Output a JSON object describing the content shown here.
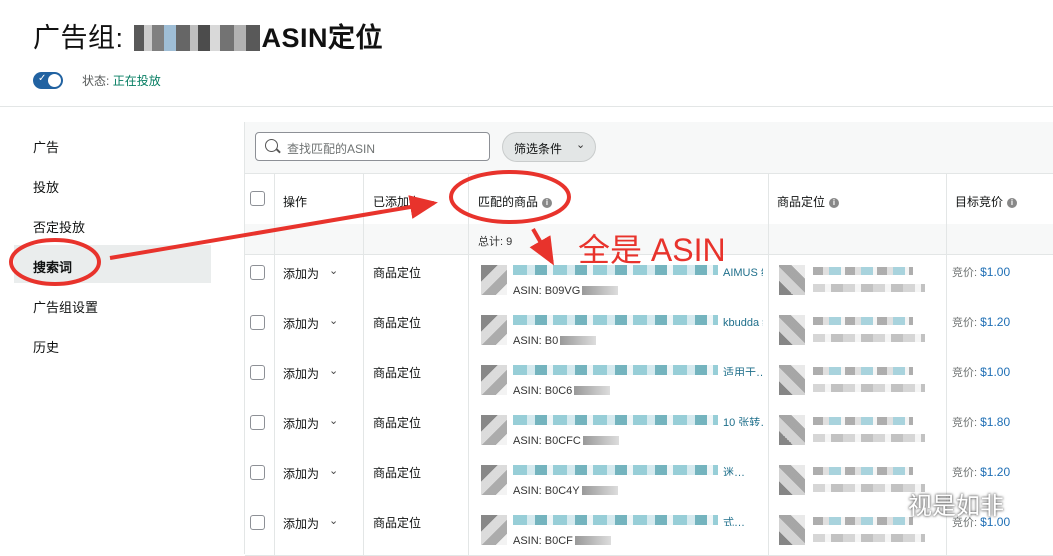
{
  "header": {
    "title_prefix": "广告组:",
    "title_suffix": "ASIN定位",
    "status_label": "状态:",
    "status_value": "正在投放"
  },
  "sidebar": {
    "items": [
      {
        "label": "广告"
      },
      {
        "label": "投放"
      },
      {
        "label": "否定投放"
      },
      {
        "label": "搜索词",
        "active": true
      },
      {
        "label": "广告组设置"
      },
      {
        "label": "历史"
      }
    ]
  },
  "toolbar": {
    "search_placeholder": "查找匹配的ASIN",
    "filter_label": "筛选条件"
  },
  "table": {
    "columns": [
      "操作",
      "已添加为",
      "匹配的商品",
      "商品定位",
      "目标竞价"
    ],
    "total_label": "总计: 9",
    "rows": [
      {
        "action": "添加为",
        "added_as": "商品定位",
        "product_title": "AIMUS 纹理复制印纸便…",
        "asin": "ASIN: B09VG",
        "bid_label": "竞价:",
        "bid": "$1.00"
      },
      {
        "action": "添加为",
        "added_as": "商品定位",
        "product_title": "kbudda 纹…",
        "asin": "ASIN: B0",
        "bid_label": "竞价:",
        "bid": "$1.20"
      },
      {
        "action": "添加为",
        "added_as": "商品定位",
        "product_title": "适用于…",
        "asin": "ASIN: B0C6",
        "bid_label": "竞价:",
        "bid": "$1.00"
      },
      {
        "action": "添加为",
        "added_as": "商品定位",
        "product_title": "10 张转…",
        "asin": "ASIN: B0CFC",
        "bid_label": "竞价:",
        "bid": "$1.80"
      },
      {
        "action": "添加为",
        "added_as": "商品定位",
        "product_title": "迷…",
        "asin": "ASIN: B0C4Y",
        "bid_label": "竞价:",
        "bid": "$1.20"
      },
      {
        "action": "添加为",
        "added_as": "商品定位",
        "product_title": "式…",
        "asin": "ASIN: B0CF",
        "bid_label": "竞价:",
        "bid": "$1.00"
      }
    ]
  },
  "annotation": {
    "text": "全是 ASIN",
    "color": "#e8332c"
  },
  "watermark": {
    "text": "视是如非"
  },
  "colors": {
    "accent": "#2162a1",
    "status_green": "#067d62",
    "link_teal": "#1f6f8b",
    "bid_blue": "#1f6fb5"
  }
}
